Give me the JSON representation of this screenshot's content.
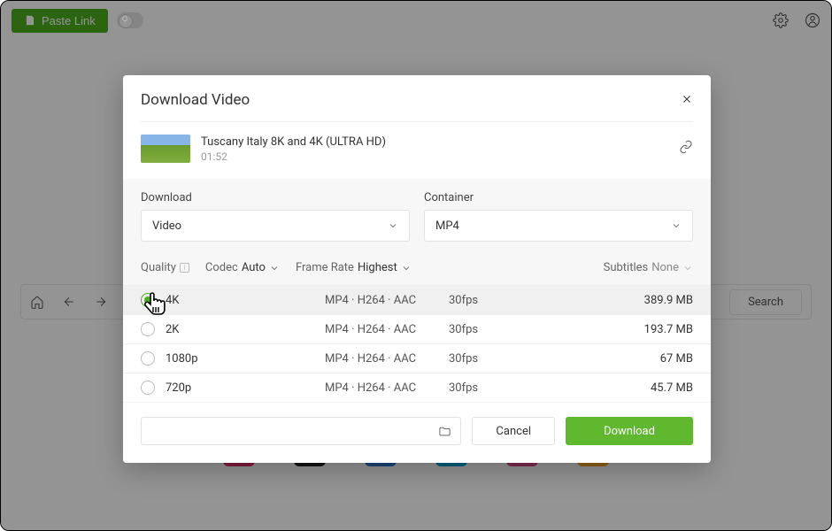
{
  "topbar": {
    "paste_label": "Paste Link"
  },
  "bgnav": {
    "search_label": "Search"
  },
  "modal": {
    "title": "Download Video",
    "video": {
      "title": "Tuscany Italy 8K and 4K (ULTRA HD)",
      "duration": "01:52"
    },
    "download_label": "Download",
    "download_value": "Video",
    "container_label": "Container",
    "container_value": "MP4",
    "filters": {
      "quality_label": "Quality",
      "codec_label": "Codec",
      "codec_value": "Auto",
      "framerate_label": "Frame Rate",
      "framerate_value": "Highest",
      "subtitles_label": "Subtitles",
      "subtitles_value": "None"
    },
    "qualities": [
      {
        "name": "4K",
        "format": "MP4 · H264 · AAC",
        "fps": "30fps",
        "size": "389.9 MB",
        "selected": true
      },
      {
        "name": "2K",
        "format": "MP4 · H264 · AAC",
        "fps": "30fps",
        "size": "193.7 MB",
        "selected": false
      },
      {
        "name": "1080p",
        "format": "MP4 · H264 · AAC",
        "fps": "30fps",
        "size": "67 MB",
        "selected": false
      },
      {
        "name": "720p",
        "format": "MP4 · H264 · AAC",
        "fps": "30fps",
        "size": "45.7 MB",
        "selected": false
      }
    ],
    "cancel_label": "Cancel",
    "confirm_label": "Download"
  }
}
